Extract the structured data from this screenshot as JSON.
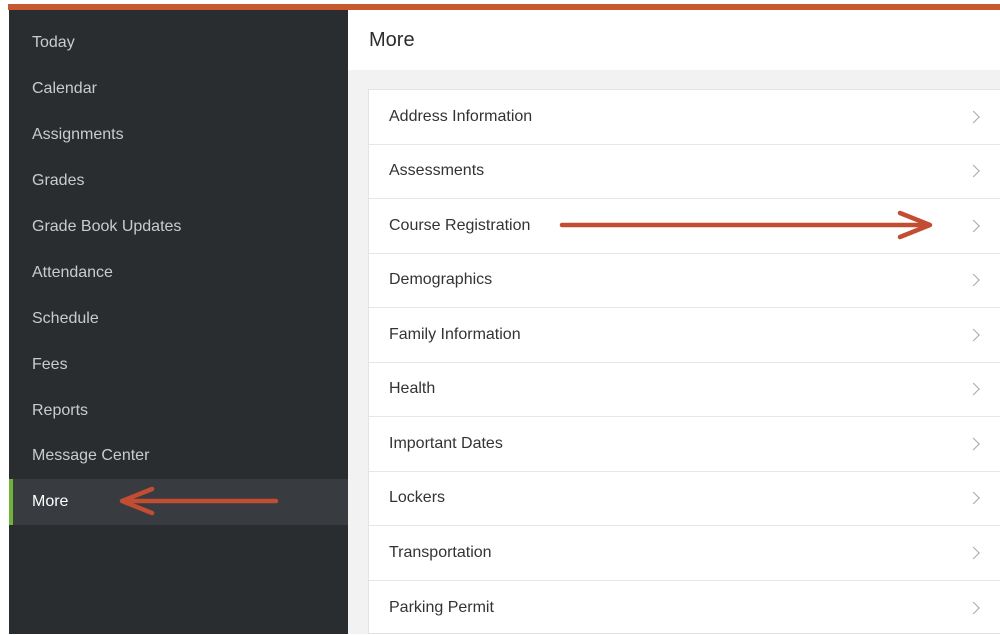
{
  "colors": {
    "sidebar_bg": "#2a2d30",
    "active_bg": "#383b3f",
    "active_marker": "#6fb43a",
    "annotation_arrow": "#c24d32",
    "top_accent": "#c8582e"
  },
  "sidebar": {
    "items": [
      {
        "label": "Today",
        "active": false
      },
      {
        "label": "Calendar",
        "active": false
      },
      {
        "label": "Assignments",
        "active": false
      },
      {
        "label": "Grades",
        "active": false
      },
      {
        "label": "Grade Book Updates",
        "active": false
      },
      {
        "label": "Attendance",
        "active": false
      },
      {
        "label": "Schedule",
        "active": false
      },
      {
        "label": "Fees",
        "active": false
      },
      {
        "label": "Reports",
        "active": false
      },
      {
        "label": "Message Center",
        "active": false
      },
      {
        "label": "More",
        "active": true
      }
    ]
  },
  "main": {
    "title": "More",
    "items": [
      {
        "label": "Address Information",
        "icon": "chevron-right-icon"
      },
      {
        "label": "Assessments",
        "icon": "chevron-right-icon"
      },
      {
        "label": "Course Registration",
        "icon": "chevron-right-icon"
      },
      {
        "label": "Demographics",
        "icon": "chevron-right-icon"
      },
      {
        "label": "Family Information",
        "icon": "chevron-right-icon"
      },
      {
        "label": "Health",
        "icon": "chevron-right-icon"
      },
      {
        "label": "Important Dates",
        "icon": "chevron-right-icon"
      },
      {
        "label": "Lockers",
        "icon": "chevron-right-icon"
      },
      {
        "label": "Transportation",
        "icon": "chevron-right-icon"
      },
      {
        "label": "Parking Permit",
        "icon": "chevron-right-icon"
      }
    ]
  },
  "annotations": [
    {
      "name": "arrow-to-course-registration",
      "icon": "arrow-right-icon"
    },
    {
      "name": "arrow-to-more",
      "icon": "arrow-left-icon"
    }
  ]
}
